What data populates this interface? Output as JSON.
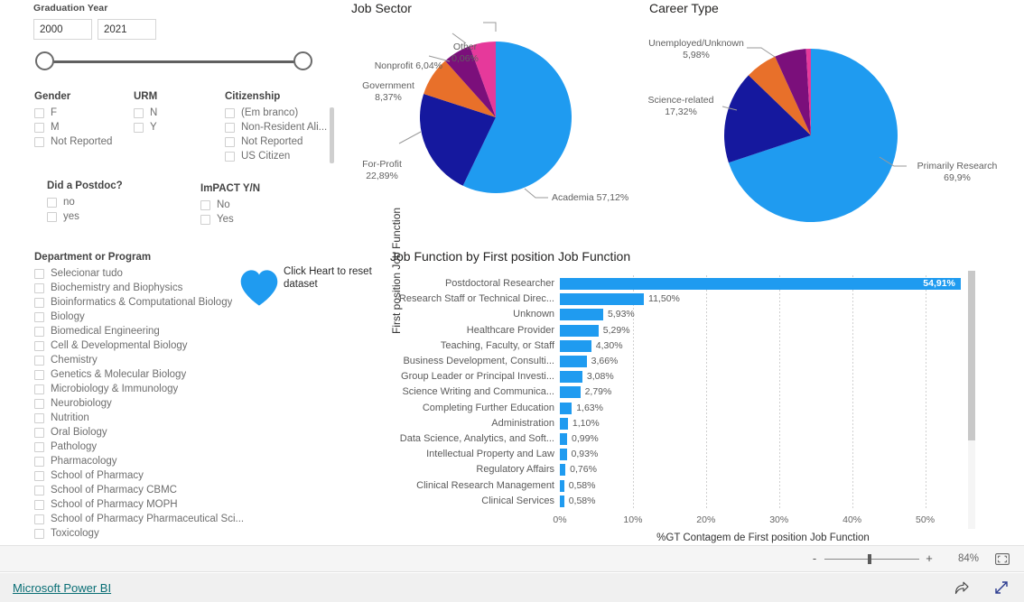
{
  "slicers": {
    "graduation_year": {
      "caption": "Graduation Year",
      "min_value": "2000",
      "max_value": "2021"
    },
    "gender": {
      "title": "Gender",
      "items": [
        "F",
        "M",
        "Not Reported"
      ]
    },
    "urm": {
      "title": "URM",
      "items": [
        "N",
        "Y"
      ]
    },
    "citizenship": {
      "title": "Citizenship",
      "items": [
        "(Em branco)",
        "Non-Resident Ali...",
        "Not Reported",
        "US Citizen"
      ]
    },
    "postdoc": {
      "title": "Did a Postdoc?",
      "items": [
        "no",
        "yes"
      ]
    },
    "impact": {
      "title": "ImPACT Y/N",
      "items": [
        "No",
        "Yes"
      ]
    },
    "department": {
      "title": "Department or Program",
      "items": [
        "Selecionar tudo",
        "Biochemistry and Biophysics",
        "Bioinformatics & Computational Biology",
        "Biology",
        "Biomedical Engineering",
        "Cell & Developmental Biology",
        "Chemistry",
        "Genetics & Molecular Biology",
        "Microbiology & Immunology",
        "Neurobiology",
        "Nutrition",
        "Oral Biology",
        "Pathology",
        "Pharmacology",
        "School of Pharmacy",
        "School of Pharmacy CBMC",
        "School of Pharmacy MOPH",
        "School of Pharmacy Pharmaceutical Sci...",
        "Toxicology"
      ]
    }
  },
  "reset": {
    "note": "Click Heart to reset dataset",
    "heart_color": "#1f9bf0"
  },
  "chart_data": [
    {
      "type": "pie",
      "title": "Job Sector",
      "categories": [
        "Academia",
        "For-Profit",
        "Government",
        "Nonprofit",
        "Other",
        "(unlabeled)"
      ],
      "values": [
        57.12,
        22.89,
        8.37,
        6.04,
        0.06,
        5.52
      ],
      "labels": [
        "Academia 57,12%",
        "For-Profit\n22,89%",
        "Government\n8,37%",
        "Nonprofit 6,04%",
        "Other\n0,06%"
      ],
      "colors": [
        "#1f9bf0",
        "#15189e",
        "#e8702a",
        "#7b0f7b",
        "#e6399b",
        "#e6399b"
      ],
      "legend": "none"
    },
    {
      "type": "pie",
      "title": "Career Type",
      "categories": [
        "Primarily Research",
        "Science-related",
        "Unemployed/Unknown",
        "(unlabeled purple)",
        "(unlabeled pink)"
      ],
      "values": [
        69.9,
        17.32,
        5.98,
        5.9,
        0.9
      ],
      "labels": [
        "Primarily Research\n69,9%",
        "Science-related\n17,32%",
        "Unemployed/Unknown\n5,98%"
      ],
      "colors": [
        "#1f9bf0",
        "#15189e",
        "#e8702a",
        "#7b0f7b",
        "#e6399b"
      ],
      "legend": "none"
    },
    {
      "type": "bar",
      "orientation": "horizontal",
      "title": "Job Function by First position Job Function",
      "ylabel": "First position Job Function",
      "xlabel": "%GT Contagem de First position Job Function",
      "xticks": [
        "0%",
        "10%",
        "20%",
        "30%",
        "40%",
        "50%"
      ],
      "xlim": [
        0,
        55
      ],
      "grid": true,
      "bar_color": "#1f9bf0",
      "categories": [
        "Postdoctoral Researcher",
        "Research Staff or Technical Direc...",
        "Unknown",
        "Healthcare Provider",
        "Teaching, Faculty, or Staff",
        "Business Development, Consulti...",
        "Group Leader or Principal Investi...",
        "Science Writing and Communica...",
        "Completing Further Education",
        "Administration",
        "Data Science, Analytics, and Soft...",
        "Intellectual Property and Law",
        "Regulatory Affairs",
        "Clinical Research Management",
        "Clinical Services"
      ],
      "values": [
        54.91,
        11.5,
        5.93,
        5.29,
        4.3,
        3.66,
        3.08,
        2.79,
        1.63,
        1.1,
        0.99,
        0.93,
        0.76,
        0.58,
        0.58
      ],
      "value_labels": [
        "54,91%",
        "11,50%",
        "5,93%",
        "5,29%",
        "4,30%",
        "3,66%",
        "3,08%",
        "2,79%",
        "1,63%",
        "1,10%",
        "0,99%",
        "0,93%",
        "0,76%",
        "0,58%",
        "0,58%"
      ]
    }
  ],
  "statusbar": {
    "zoom_out_label": "-",
    "zoom_in_label": "+",
    "zoom_percent": "84%",
    "fit_icon": "fit-to-page-icon"
  },
  "footer": {
    "brand_link": "Microsoft Power BI",
    "share_icon": "share-icon",
    "fullscreen_icon": "fullscreen-icon"
  }
}
